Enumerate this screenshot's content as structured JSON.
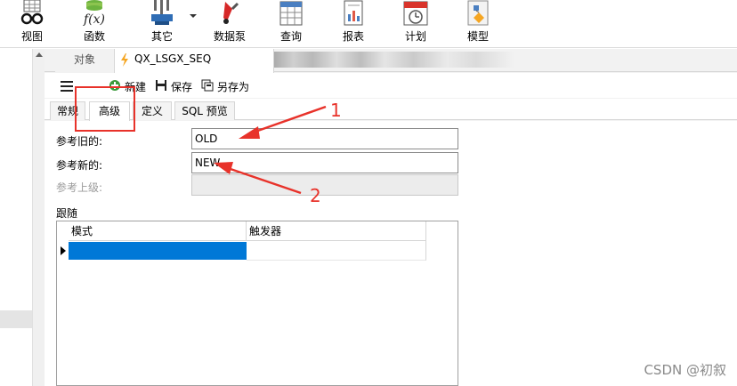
{
  "ribbon": {
    "items": [
      {
        "label": "视图",
        "icon": "view-icon"
      },
      {
        "label": "函数",
        "icon": "function-icon"
      },
      {
        "label": "其它",
        "icon": "other-icon"
      },
      {
        "label": "数据泵",
        "icon": "datapump-icon"
      },
      {
        "label": "查询",
        "icon": "query-icon"
      },
      {
        "label": "报表",
        "icon": "report-icon"
      },
      {
        "label": "计划",
        "icon": "schedule-icon"
      },
      {
        "label": "模型",
        "icon": "model-icon"
      }
    ]
  },
  "tabs": {
    "objects_label": "对象",
    "document_title": "QX_LSGX_SEQ"
  },
  "toolbar": {
    "new_label": "新建",
    "save_label": "保存",
    "save_as_label": "另存为"
  },
  "subtabs": [
    "常规",
    "高级",
    "定义",
    "SQL 预览"
  ],
  "form": {
    "ref_old_label": "参考旧的:",
    "ref_old_value": "OLD",
    "ref_new_label": "参考新的:",
    "ref_new_value": "NEW",
    "ref_parent_label": "参考上级:",
    "ref_parent_value": "",
    "follow_label": "跟随",
    "grid_headers": [
      "模式",
      "触发器"
    ]
  },
  "annotations": {
    "marker_1": "1",
    "marker_2": "2",
    "color": "#e8322a"
  },
  "colors": {
    "selection": "#0078d7",
    "accent_bolt": "#f5a623"
  },
  "watermark": "CSDN @初叙"
}
